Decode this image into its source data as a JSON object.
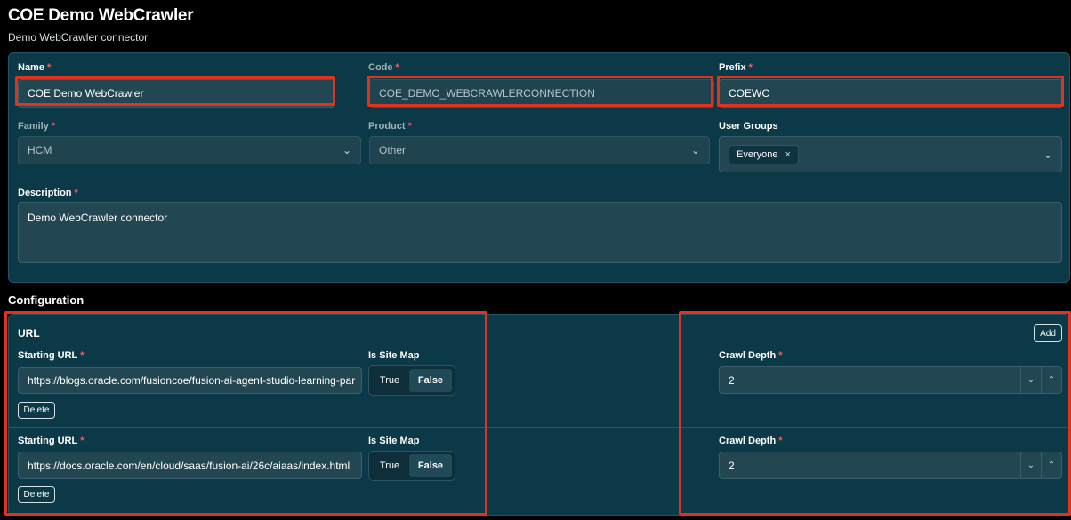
{
  "header": {
    "title": "COE Demo WebCrawler",
    "subtitle": "Demo WebCrawler connector"
  },
  "form": {
    "name": {
      "label": "Name",
      "required": "*",
      "value": "COE Demo WebCrawler"
    },
    "code": {
      "label": "Code",
      "required": "*",
      "value": "COE_DEMO_WEBCRAWLERCONNECTION"
    },
    "prefix": {
      "label": "Prefix",
      "required": "*",
      "value": "COEWC"
    },
    "family": {
      "label": "Family",
      "required": "*",
      "value": "HCM"
    },
    "product": {
      "label": "Product",
      "required": "*",
      "value": "Other"
    },
    "user_groups": {
      "label": "User Groups",
      "chips": [
        "Everyone"
      ]
    },
    "description": {
      "label": "Description",
      "required": "*",
      "value": "Demo WebCrawler connector"
    }
  },
  "configuration": {
    "title": "Configuration",
    "url_heading": "URL",
    "add_label": "Add",
    "entries": [
      {
        "starting_url_label": "Starting URL",
        "required": "*",
        "starting_url": "https://blogs.oracle.com/fusioncoe/fusion-ai-agent-studio-learning-par",
        "is_site_map_label": "Is Site Map",
        "true_label": "True",
        "false_label": "False",
        "delete_label": "Delete",
        "crawl_depth_label": "Crawl Depth",
        "crawl_depth": "2"
      },
      {
        "starting_url_label": "Starting URL",
        "required": "*",
        "starting_url": "https://docs.oracle.com/en/cloud/saas/fusion-ai/26c/aiaas/index.html",
        "is_site_map_label": "Is Site Map",
        "true_label": "True",
        "false_label": "False",
        "delete_label": "Delete",
        "crawl_depth_label": "Crawl Depth",
        "crawl_depth": "2"
      }
    ]
  },
  "icons": {
    "chevron_down": "⌄",
    "close": "×",
    "step_down": "⌄",
    "step_up": "⌃"
  },
  "colors": {
    "background": "#000000",
    "card": "#0b3947",
    "field": "#224753",
    "required": "#ff5a57",
    "highlight": "#e0331e"
  }
}
